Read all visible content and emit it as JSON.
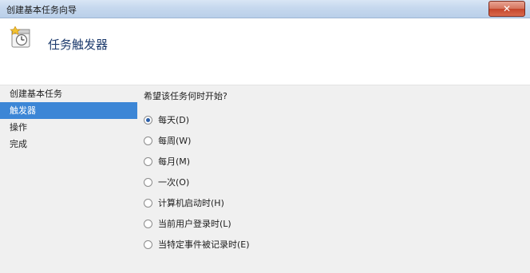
{
  "window": {
    "title": "创建基本任务向导",
    "close_symbol": "✕"
  },
  "header": {
    "title": "任务触发器",
    "icon": "task-trigger-clock-icon"
  },
  "nav": {
    "items": [
      {
        "label": "创建基本任务",
        "active": false
      },
      {
        "label": "触发器",
        "active": true
      },
      {
        "label": "操作",
        "active": false
      },
      {
        "label": "完成",
        "active": false
      }
    ]
  },
  "content": {
    "question": "希望该任务何时开始?",
    "options": [
      {
        "label": "每天(D)",
        "checked": true
      },
      {
        "label": "每周(W)",
        "checked": false
      },
      {
        "label": "每月(M)",
        "checked": false
      },
      {
        "label": "一次(O)",
        "checked": false
      },
      {
        "label": "计算机启动时(H)",
        "checked": false
      },
      {
        "label": "当前用户登录时(L)",
        "checked": false
      },
      {
        "label": "当特定事件被记录时(E)",
        "checked": false
      }
    ]
  },
  "colors": {
    "accent": "#3c86d6",
    "header_title": "#1e3c6e",
    "close": "#c4452b"
  }
}
